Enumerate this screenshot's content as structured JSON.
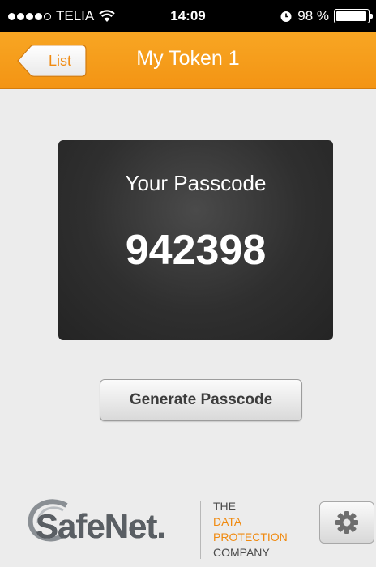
{
  "status_bar": {
    "carrier": "TELIA",
    "time": "14:09",
    "battery_text": "98 %",
    "battery_level": 0.98,
    "signal_bars": 4,
    "signal_max": 5,
    "icons": [
      "signal-dots-icon",
      "wifi-icon",
      "alarm-clock-icon",
      "battery-icon"
    ]
  },
  "nav": {
    "title": "My Token 1",
    "back_label": "List"
  },
  "passcode": {
    "label": "Your Passcode",
    "value": "942398"
  },
  "actions": {
    "generate_label": "Generate Passcode"
  },
  "footer": {
    "logo_text": "SafeNet.",
    "tagline": [
      "THE",
      "DATA",
      "PROTECTION",
      "COMPANY"
    ],
    "settings_icon": "gear-icon"
  },
  "colors": {
    "accent": "#f39414",
    "card_bg": "#2f2f2f",
    "page_bg": "#ececec"
  }
}
